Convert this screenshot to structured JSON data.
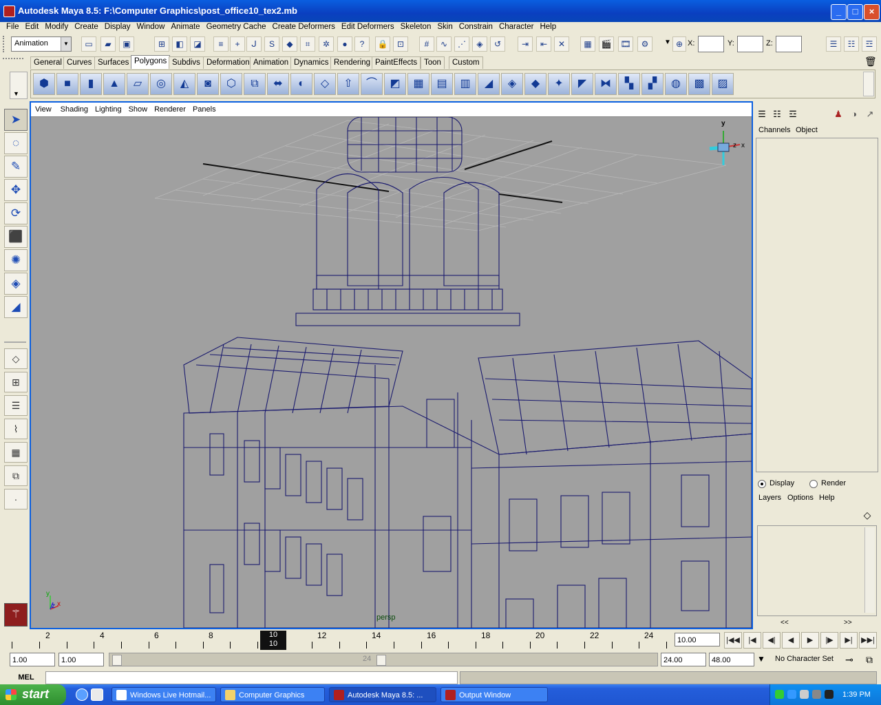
{
  "window": {
    "title": "Autodesk Maya 8.5: F:\\Computer Graphics\\post_office10_tex2.mb",
    "minimize": "_",
    "maximize": "□",
    "close": "×"
  },
  "menubar": [
    "File",
    "Edit",
    "Modify",
    "Create",
    "Display",
    "Window",
    "Animate",
    "Geometry Cache",
    "Create Deformers",
    "Edit Deformers",
    "Skeleton",
    "Skin",
    "Constrain",
    "Character",
    "Help"
  ],
  "statusline": {
    "mode": "Animation",
    "x_label": "X:",
    "y_label": "Y:",
    "z_label": "Z:",
    "x_value": "",
    "y_value": "",
    "z_value": ""
  },
  "shelf_tabs": [
    "General",
    "Curves",
    "Surfaces",
    "Polygons",
    "Subdivs",
    "Deformation",
    "Animation",
    "Dynamics",
    "Rendering",
    "PaintEffects",
    "Toon",
    "Custom"
  ],
  "active_shelf": "Polygons",
  "viewport": {
    "menu": [
      "View",
      "Shading",
      "Lighting",
      "Show",
      "Renderer",
      "Panels"
    ],
    "camera_label": "persp",
    "axis_y": "y",
    "axis_x": "x",
    "axis_z": "z",
    "view_cube_y": "y",
    "view_cube_x": "x",
    "view_cube_z": "z",
    "wire_color": "#1a1a6e",
    "background": "#a0a0a0"
  },
  "channel_box": {
    "tab_channels": "Channels",
    "tab_object": "Object"
  },
  "layer_editor": {
    "display": "Display",
    "render": "Render",
    "menu_layers": "Layers",
    "menu_options": "Options",
    "menu_help": "Help",
    "mode_selected": "Display",
    "nav_left": "<<",
    "nav_right": ">>"
  },
  "time_slider": {
    "labels": [
      "2",
      "4",
      "6",
      "8",
      "10",
      "12",
      "14",
      "16",
      "18",
      "20",
      "22",
      "24"
    ],
    "current_frame": "10",
    "current_time_field": "10.00"
  },
  "range_slider": {
    "start_time": "1.00",
    "playback_start": "1.00",
    "range_end_label": "24",
    "playback_end": "24.00",
    "end_time": "48.00",
    "character_set": "No Character Set"
  },
  "command_line": {
    "label": "MEL"
  },
  "taskbar": {
    "start": "start",
    "items": [
      {
        "label": "Windows Live Hotmail..."
      },
      {
        "label": "Computer Graphics"
      },
      {
        "label": "Autodesk Maya 8.5: ..."
      },
      {
        "label": "Output Window"
      }
    ],
    "clock": "1:39 PM"
  },
  "colors": {
    "titlebar": "#0a5fe0",
    "viewport_border": "#0a5fe0",
    "ui_gray": "#ece9d8",
    "taskbar": "#245edb",
    "start_green": "#3a9c3a"
  }
}
